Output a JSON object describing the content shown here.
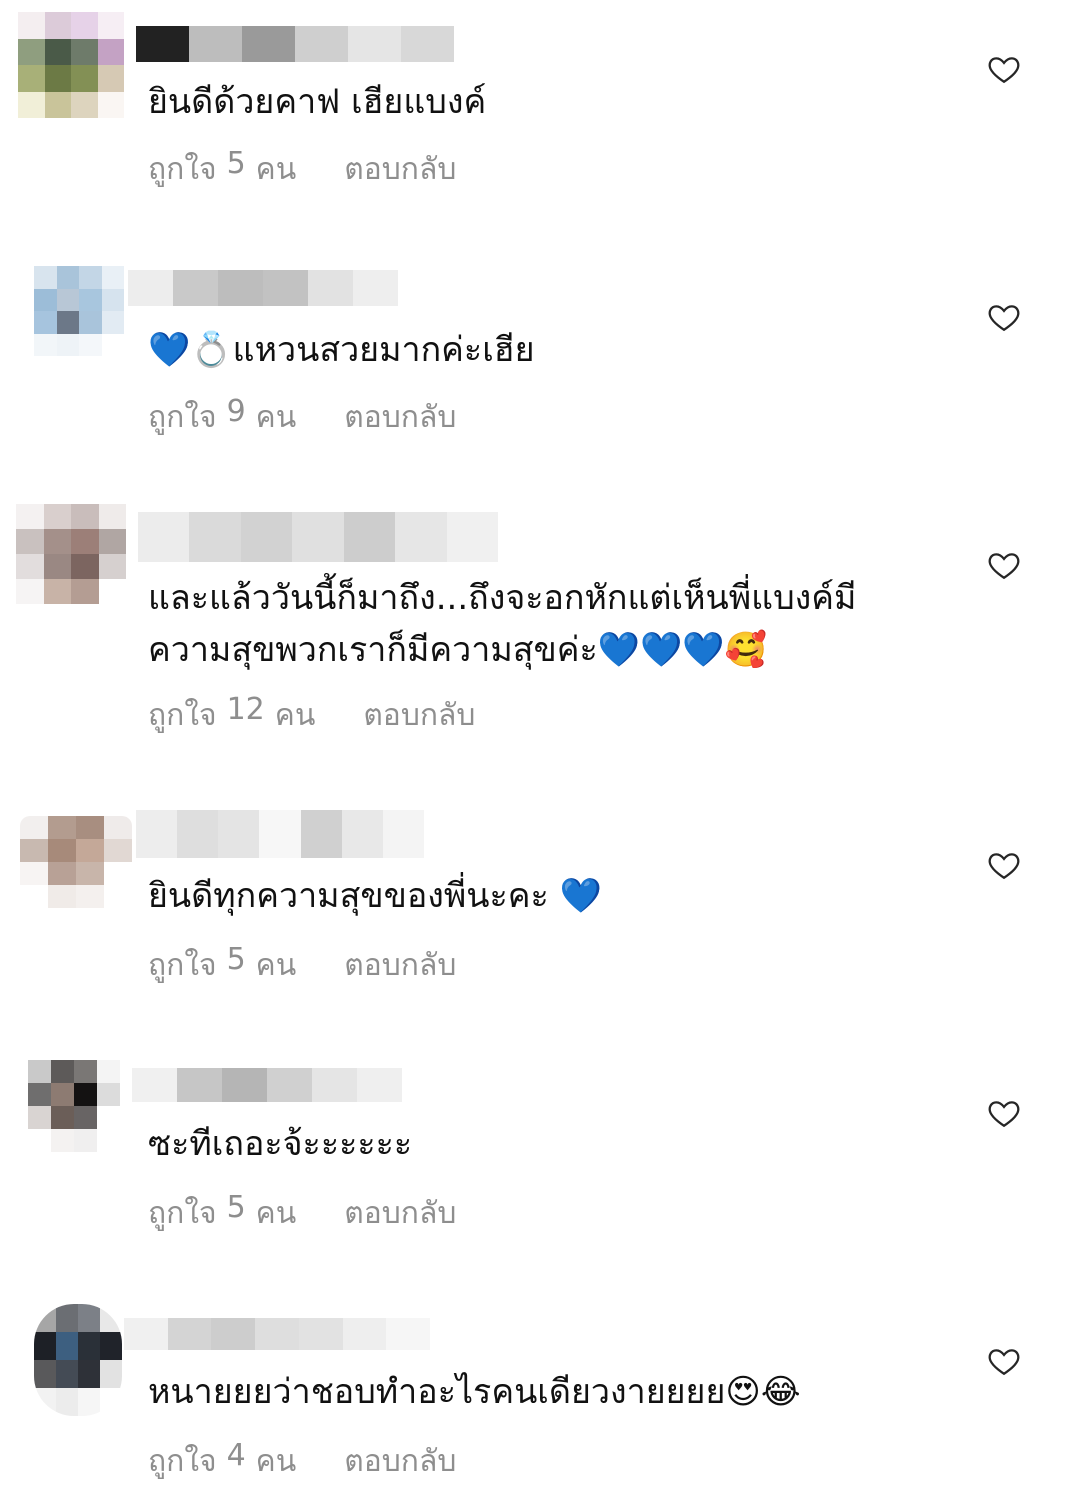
{
  "comments": [
    {
      "text": "ยินดีด้วยคาฟ เฮียแบงค์",
      "likes_prefix": "ถูกใจ",
      "likes_count": "5",
      "likes_suffix": "คน",
      "reply": "ตอบกลับ",
      "like_icon": "heart-outline-icon"
    },
    {
      "text": "💙💍แหวนสวยมากค่ะเฮีย",
      "likes_prefix": "ถูกใจ",
      "likes_count": "9",
      "likes_suffix": "คน",
      "reply": "ตอบกลับ",
      "like_icon": "heart-outline-icon"
    },
    {
      "text": "และแล้ววันนี้ก็มาถึง...ถึงจะอกหักแต่เห็นพี่แบงค์มีความสุขพวกเราก็มีความสุขค่ะ💙💙💙🥰",
      "likes_prefix": "ถูกใจ",
      "likes_count": "12",
      "likes_suffix": "คน",
      "reply": "ตอบกลับ",
      "like_icon": "heart-outline-icon"
    },
    {
      "text": "ยินดีทุกความสุขของพี่นะคะ 💙",
      "likes_prefix": "ถูกใจ",
      "likes_count": "5",
      "likes_suffix": "คน",
      "reply": "ตอบกลับ",
      "like_icon": "heart-outline-icon"
    },
    {
      "text": "ซะทีเถอะจ้ะะะะะะ",
      "likes_prefix": "ถูกใจ",
      "likes_count": "5",
      "likes_suffix": "คน",
      "reply": "ตอบกลับ",
      "like_icon": "heart-outline-icon"
    },
    {
      "text": "หนายยยว่าชอบทำอะไรคนเดียวงายยยย😍😂",
      "likes_prefix": "ถูกใจ",
      "likes_count": "4",
      "likes_suffix": "คน",
      "reply": "ตอบกลับ",
      "like_icon": "heart-outline-icon"
    }
  ],
  "colors": {
    "text": "#111111",
    "meta": "#8e8e8e",
    "heart_stroke": "#262626",
    "background": "#ffffff"
  }
}
